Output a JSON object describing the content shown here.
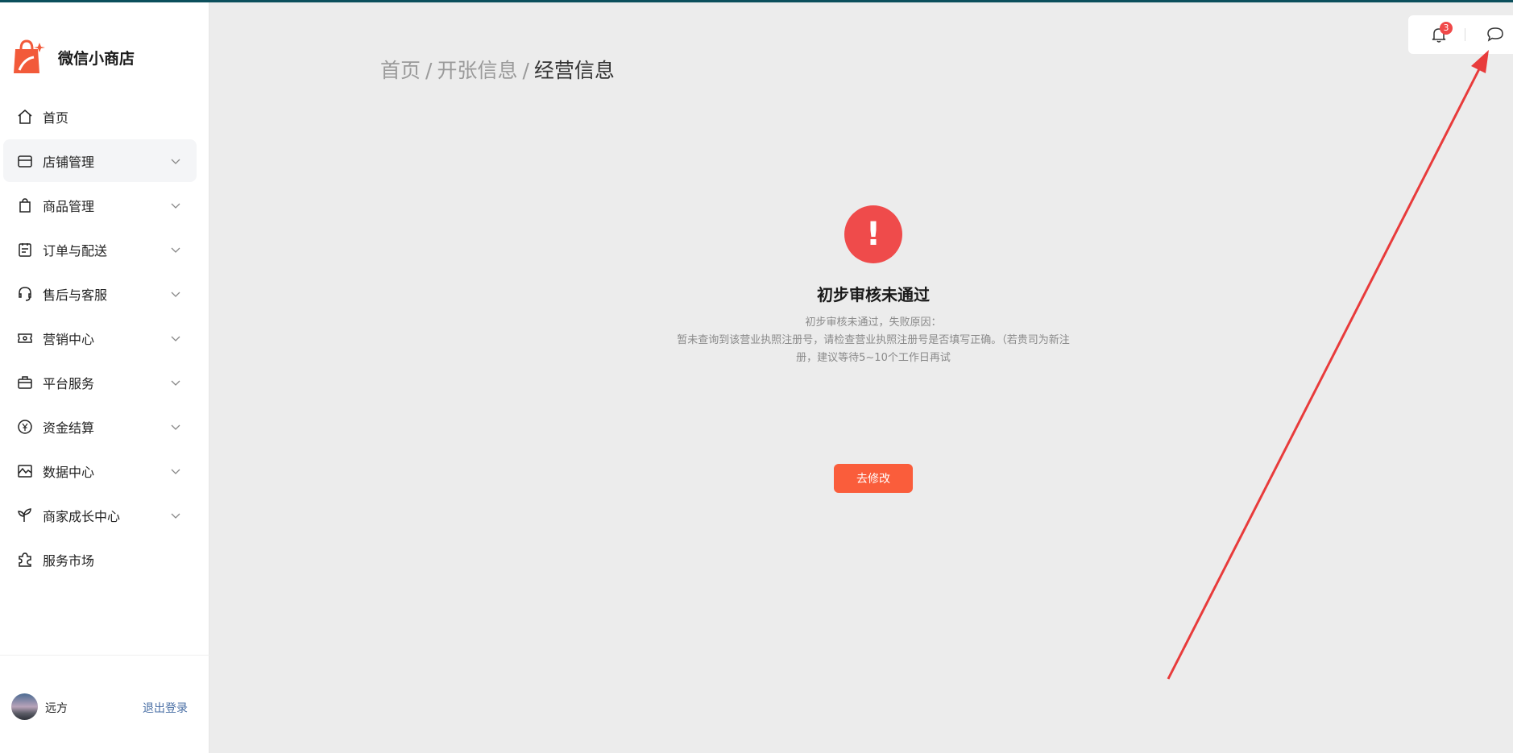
{
  "brand": {
    "name": "微信小商店"
  },
  "sidebar": {
    "items": [
      {
        "label": "首页",
        "icon": "home-icon",
        "chevron": false,
        "active": false
      },
      {
        "label": "店铺管理",
        "icon": "store-icon",
        "chevron": true,
        "active": true
      },
      {
        "label": "商品管理",
        "icon": "shopping-bag-icon",
        "chevron": true,
        "active": false
      },
      {
        "label": "订单与配送",
        "icon": "clipboard-icon",
        "chevron": true,
        "active": false
      },
      {
        "label": "售后与客服",
        "icon": "headset-icon",
        "chevron": true,
        "active": false
      },
      {
        "label": "营销中心",
        "icon": "ticket-icon",
        "chevron": true,
        "active": false
      },
      {
        "label": "平台服务",
        "icon": "briefcase-icon",
        "chevron": true,
        "active": false
      },
      {
        "label": "资金结算",
        "icon": "yen-coin-icon",
        "chevron": true,
        "active": false
      },
      {
        "label": "数据中心",
        "icon": "chart-icon",
        "chevron": true,
        "active": false
      },
      {
        "label": "商家成长中心",
        "icon": "sprout-icon",
        "chevron": true,
        "active": false
      },
      {
        "label": "服务市场",
        "icon": "puzzle-icon",
        "chevron": false,
        "active": false
      }
    ],
    "user": {
      "name": "远方",
      "logout_label": "退出登录"
    }
  },
  "header": {
    "notification_count": "3"
  },
  "breadcrumb": {
    "home": "首页",
    "parent": "开张信息",
    "current": "经营信息",
    "separator": "/"
  },
  "status": {
    "icon_glyph": "!",
    "title": "初步审核未通过",
    "reason_label": "初步审核未通过，失败原因：",
    "reason_text": "暂未查询到该营业执照注册号，请检查营业执照注册号是否填写正确。（若贵司为新注册，建议等待5~10个工作日再试"
  },
  "actions": {
    "fix_label": "去修改"
  },
  "colors": {
    "accent": "#fa5d3b",
    "error": "#ef4b4b",
    "annotation_arrow": "#e83b3b"
  }
}
